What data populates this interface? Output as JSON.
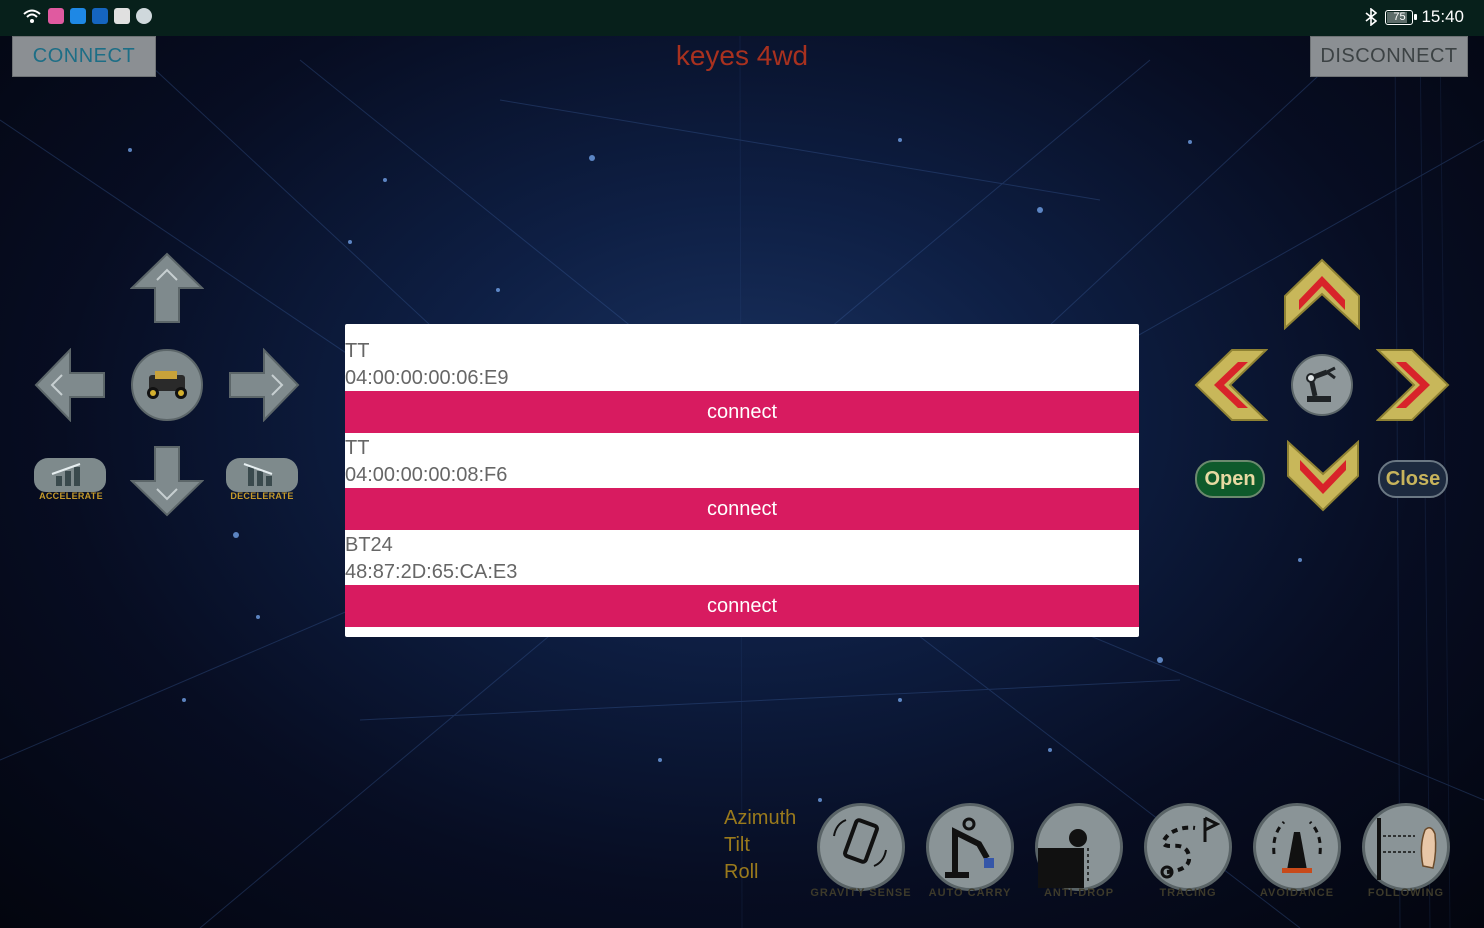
{
  "status_bar": {
    "time": "15:40",
    "battery": "75",
    "icons": [
      "wifi-icon",
      "app-icon-pink",
      "search-app-icon",
      "lightbulb-app-icon",
      "upload-app-icon",
      "globe-app-icon",
      "bluetooth-icon"
    ]
  },
  "header": {
    "connect_label": "CONNECT",
    "title": "keyes 4wd",
    "disconnect_label": "DISCONNECT"
  },
  "left_pad": {
    "accelerate_label": "ACCELERATE",
    "decelerate_label": "DECELERATE"
  },
  "arm_pad": {
    "open_label": "Open",
    "close_label": "Close"
  },
  "sensors": {
    "azimuth_label": "Azimuth",
    "tilt_label": "Tilt",
    "roll_label": "Roll"
  },
  "modes": [
    {
      "label": "GRAVITY SENSE",
      "icon": "phone-rotate-icon"
    },
    {
      "label": "AUTO CARRY",
      "icon": "robot-arm-icon"
    },
    {
      "label": "ANTI-DROP",
      "icon": "cliff-edge-icon"
    },
    {
      "label": "TRACING",
      "icon": "path-flag-icon"
    },
    {
      "label": "AVOIDANCE",
      "icon": "traffic-cone-icon"
    },
    {
      "label": "FOLLOWING",
      "icon": "hand-wall-icon"
    }
  ],
  "dialog": {
    "devices": [
      {
        "name": "TT",
        "address": "04:00:00:00:06:E9",
        "button": "connect"
      },
      {
        "name": "TT",
        "address": "04:00:00:00:08:F6",
        "button": "connect"
      },
      {
        "name": "BT24",
        "address": "48:87:2D:65:CA:E3",
        "button": "connect"
      }
    ]
  },
  "colors": {
    "connect_button": "#d81b60",
    "title": "#a8311f",
    "status_bar": "#07201b"
  }
}
